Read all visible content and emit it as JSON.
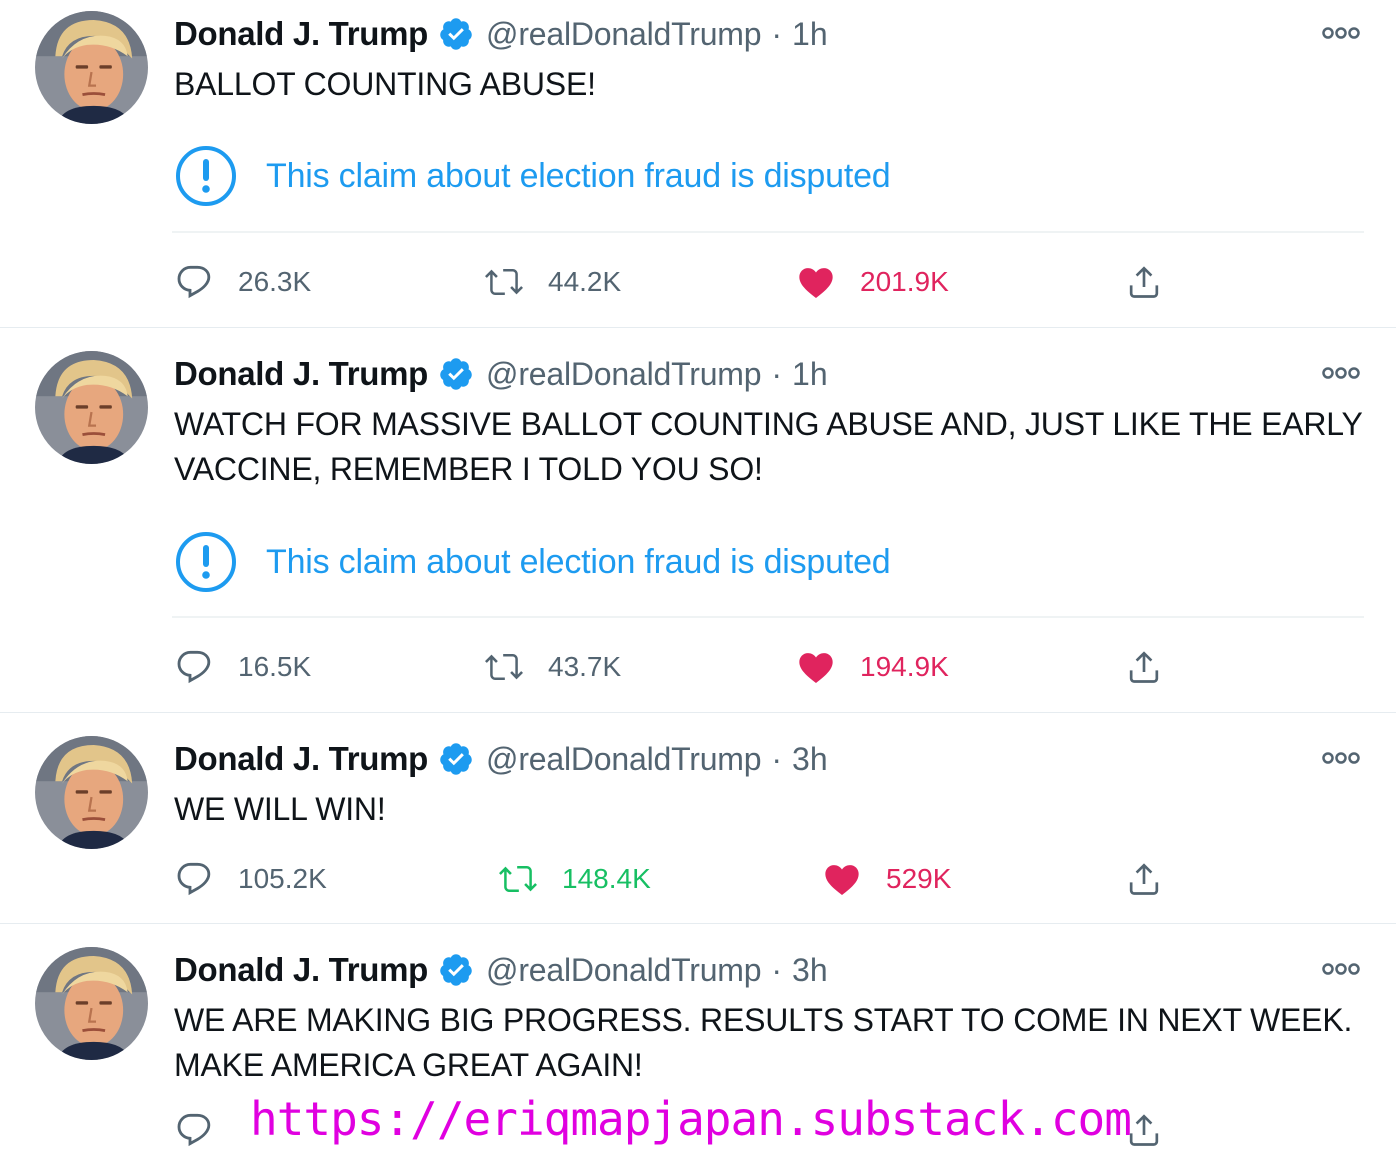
{
  "accent_color": "#1d9bf0",
  "like_color": "#e0245e",
  "retweet_active_color": "#17bf63",
  "tweets": [
    {
      "name": "Donald J. Trump",
      "handle": "@realDonaldTrump",
      "separator": "·",
      "time": "1h",
      "text": "BALLOT COUNTING ABUSE!",
      "notice": "This claim about election fraud is disputed",
      "replies": "26.3K",
      "retweets": "44.2K",
      "likes": "201.9K",
      "liked": true,
      "retweeted": false
    },
    {
      "name": "Donald J. Trump",
      "handle": "@realDonaldTrump",
      "separator": "·",
      "time": "1h",
      "text": "WATCH FOR MASSIVE BALLOT COUNTING ABUSE AND, JUST LIKE THE EARLY VACCINE, REMEMBER I TOLD YOU SO!",
      "notice": "This claim about election fraud is disputed",
      "replies": "16.5K",
      "retweets": "43.7K",
      "likes": "194.9K",
      "liked": true,
      "retweeted": false
    },
    {
      "name": "Donald J. Trump",
      "handle": "@realDonaldTrump",
      "separator": "·",
      "time": "3h",
      "text": "WE WILL WIN!",
      "replies": "105.2K",
      "retweets": "148.4K",
      "likes": "529K",
      "liked": true,
      "retweeted": true
    },
    {
      "name": "Donald J. Trump",
      "handle": "@realDonaldTrump",
      "separator": "·",
      "time": "3h",
      "text": "WE ARE MAKING BIG PROGRESS. RESULTS START TO COME IN NEXT WEEK. MAKE AMERICA GREAT AGAIN!"
    }
  ],
  "icons": {
    "avatar": "avatar-photo",
    "verified": "verified-badge-icon",
    "more": "more-options-icon",
    "notice": "exclamation-circle-icon",
    "reply": "reply-icon",
    "retweet": "retweet-icon",
    "like": "heart-icon",
    "share": "share-icon"
  },
  "watermark": "https://eriqmapjapan.substack.com"
}
